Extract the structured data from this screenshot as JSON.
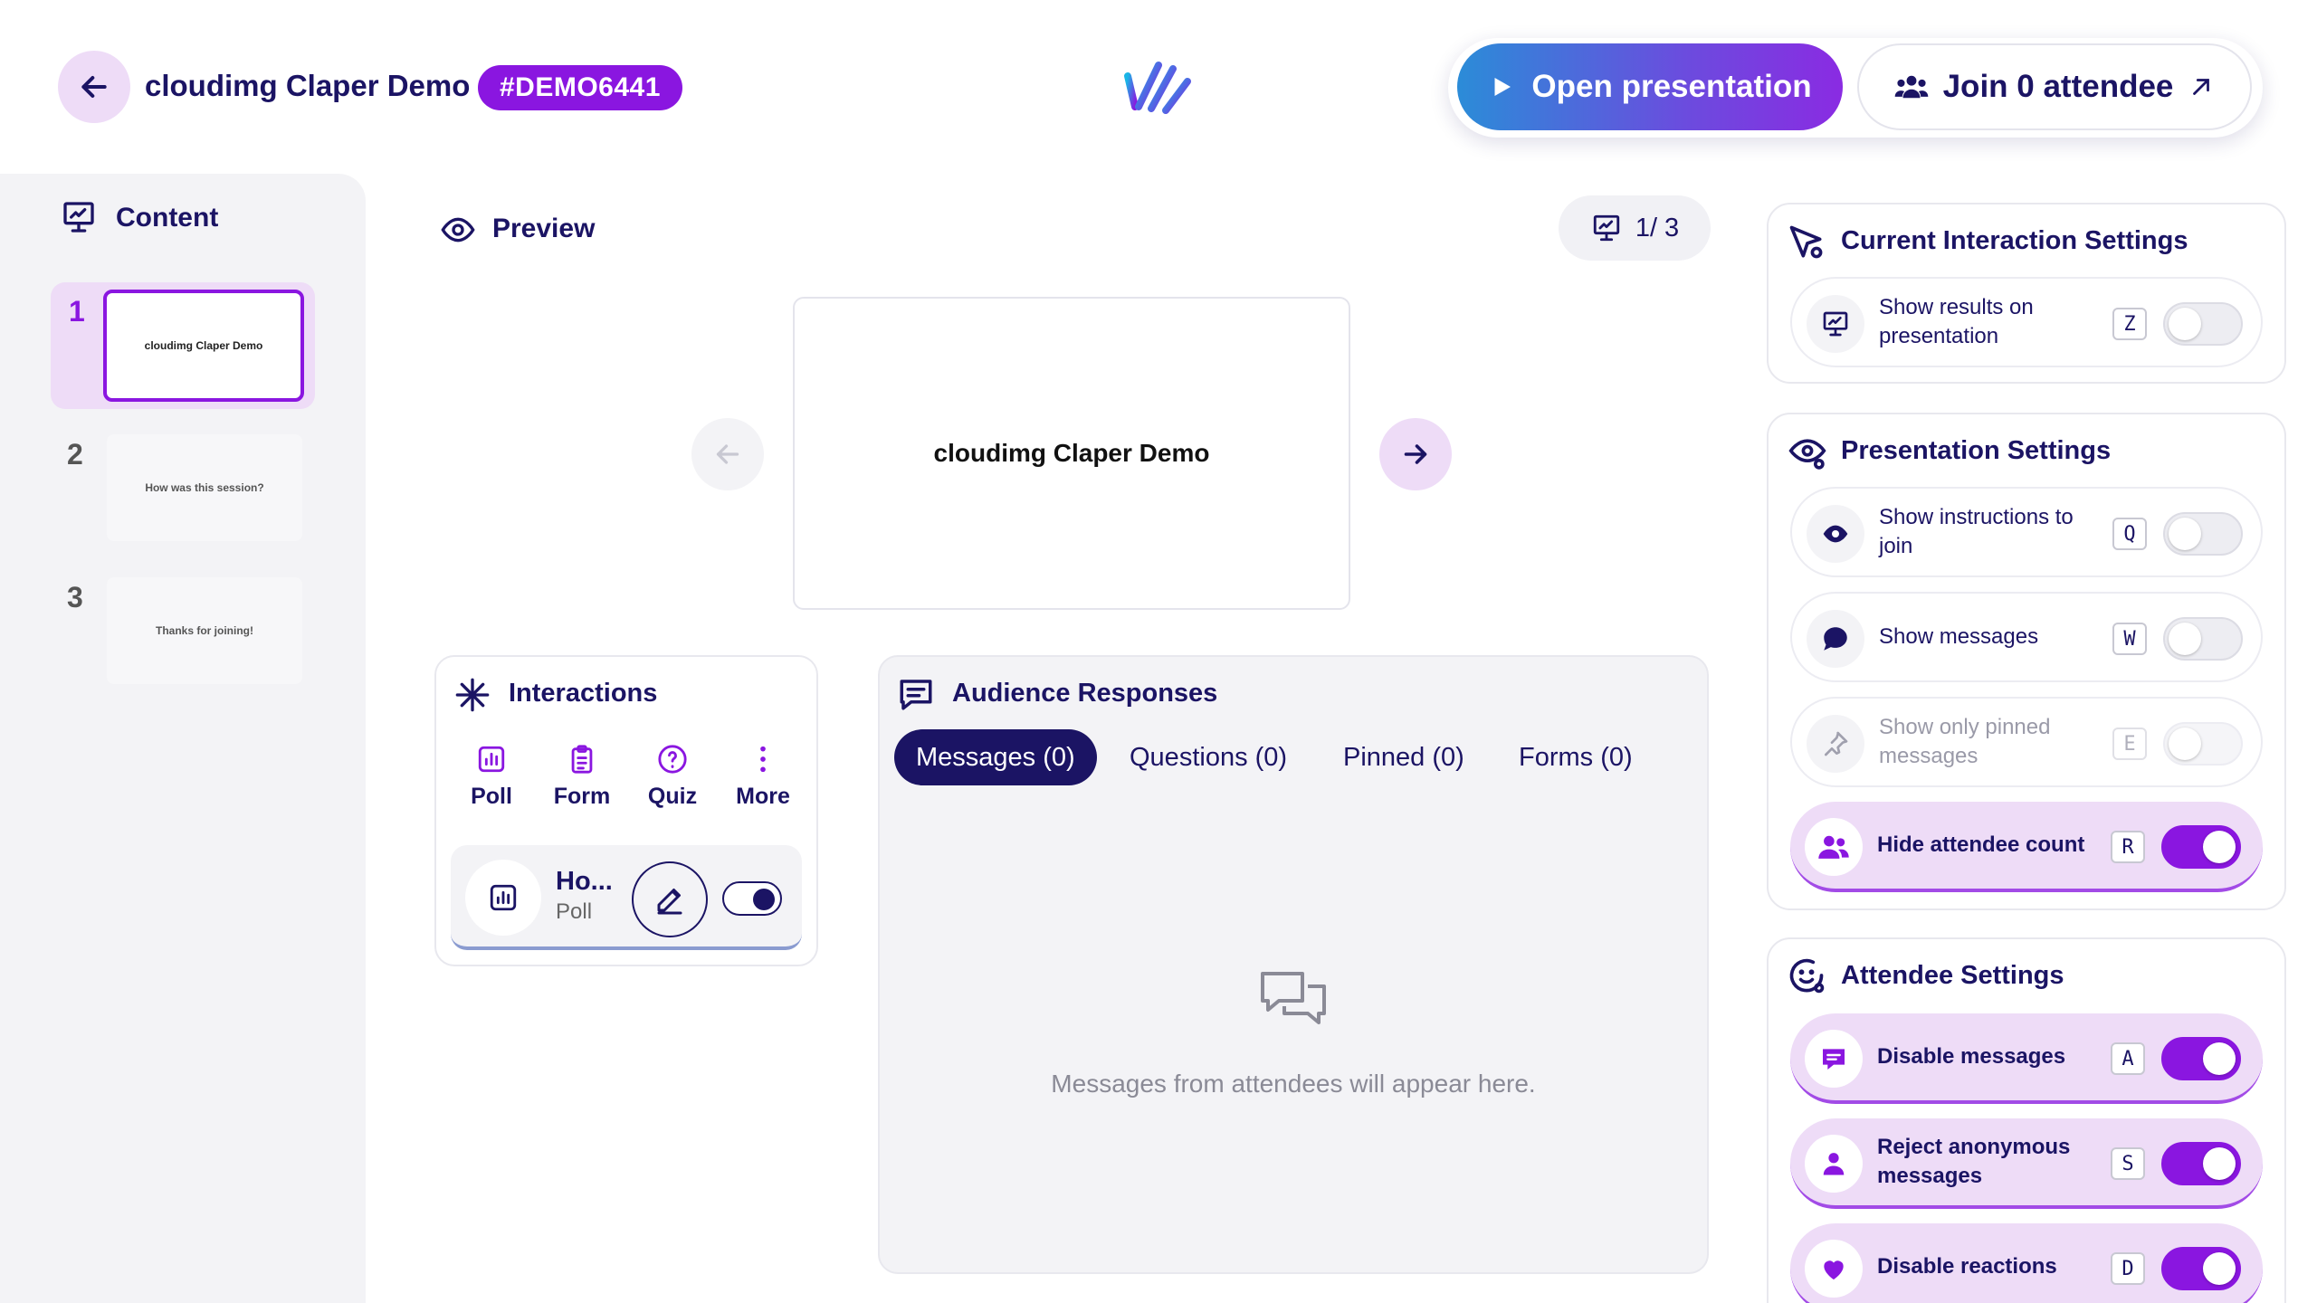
{
  "header": {
    "title": "cloudimg Claper Demo",
    "code": "#DEMO6441",
    "open_presentation": "Open presentation",
    "join_attendee": "Join 0 attendee"
  },
  "sidebar": {
    "title": "Content",
    "slides": [
      {
        "number": "1",
        "text": "cloudimg Claper Demo",
        "active": true
      },
      {
        "number": "2",
        "text": "How was this session?",
        "active": false
      },
      {
        "number": "3",
        "text": "Thanks for joining!",
        "active": false
      }
    ]
  },
  "preview": {
    "label": "Preview",
    "counter": "1/ 3",
    "slide_text": "cloudimg Claper Demo"
  },
  "interactions": {
    "title": "Interactions",
    "tools": [
      {
        "label": "Poll",
        "icon": "poll-icon"
      },
      {
        "label": "Form",
        "icon": "form-icon"
      },
      {
        "label": "Quiz",
        "icon": "quiz-icon"
      },
      {
        "label": "More",
        "icon": "more-icon"
      }
    ],
    "item": {
      "title": "Ho...",
      "type": "Poll"
    }
  },
  "audience": {
    "title": "Audience Responses",
    "tabs": [
      "Messages (0)",
      "Questions (0)",
      "Pinned (0)",
      "Forms (0)"
    ],
    "active_tab": 0,
    "empty": "Messages from attendees will appear here."
  },
  "current_interaction": {
    "title": "Current Interaction Settings",
    "rows": [
      {
        "label": "Show results on presentation",
        "key": "Z",
        "on": false
      }
    ]
  },
  "presentation_settings": {
    "title": "Presentation Settings",
    "rows": [
      {
        "label": "Show instructions to join",
        "key": "Q",
        "on": false
      },
      {
        "label": "Show messages",
        "key": "W",
        "on": false
      },
      {
        "label": "Show only pinned messages",
        "key": "E",
        "on": false,
        "disabled": true
      },
      {
        "label": "Hide attendee count",
        "key": "R",
        "on": true
      }
    ]
  },
  "attendee_settings": {
    "title": "Attendee Settings",
    "rows": [
      {
        "label": "Disable messages",
        "key": "A",
        "on": true
      },
      {
        "label": "Reject anonymous messages",
        "key": "S",
        "on": true
      },
      {
        "label": "Disable reactions",
        "key": "D",
        "on": true
      }
    ]
  },
  "colors": {
    "accent": "#8a16e0",
    "navy": "#1b1464",
    "lavender": "#eedcf7"
  }
}
